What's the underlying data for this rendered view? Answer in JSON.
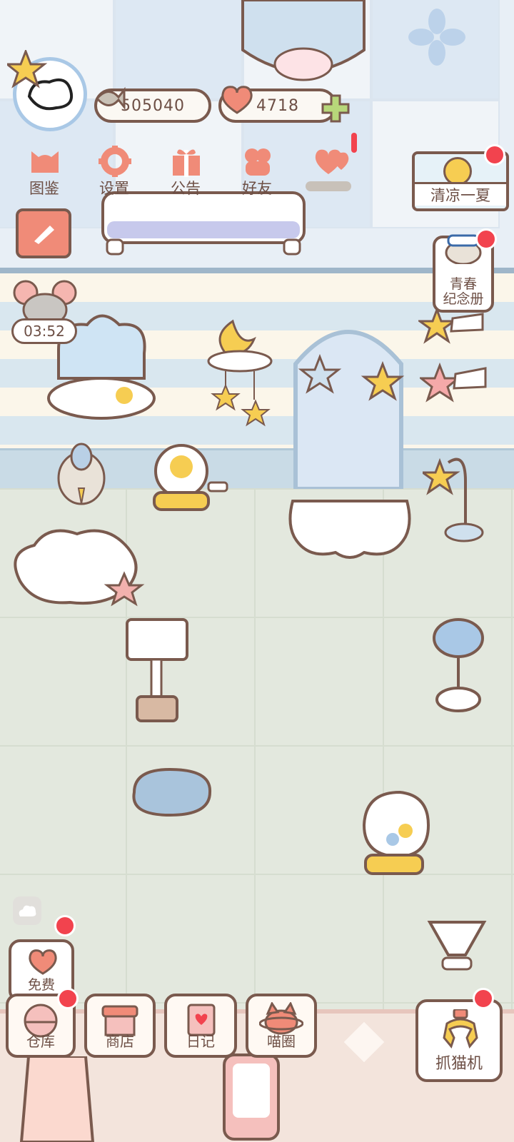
{
  "hud": {
    "fish_currency": "505040",
    "heart_currency": "4718",
    "timer": "03:52"
  },
  "top_menu": [
    {
      "label": "图鉴",
      "icon": "cat-head-icon"
    },
    {
      "label": "设置",
      "icon": "gear-icon"
    },
    {
      "label": "公告",
      "icon": "gift-icon"
    },
    {
      "label": "好友",
      "icon": "friends-icon"
    }
  ],
  "events": {
    "summer": "清凉一夏",
    "youth_album_line1": "青春",
    "youth_album_line2": "纪念册"
  },
  "bottom_menu": [
    {
      "label": "仓库",
      "icon": "warehouse-icon"
    },
    {
      "label": "商店",
      "icon": "shop-icon"
    },
    {
      "label": "日记",
      "icon": "diary-icon"
    },
    {
      "label": "喵圈",
      "icon": "cat-planet-icon"
    }
  ],
  "free_label": "免费",
  "claw_label": "抓猫机",
  "colors": {
    "outline": "#7a5a4e",
    "badge": "#f2434e",
    "accent_pink": "#f08b78",
    "wall_blue": "#dde8f3",
    "floor": "#e3e8de"
  }
}
